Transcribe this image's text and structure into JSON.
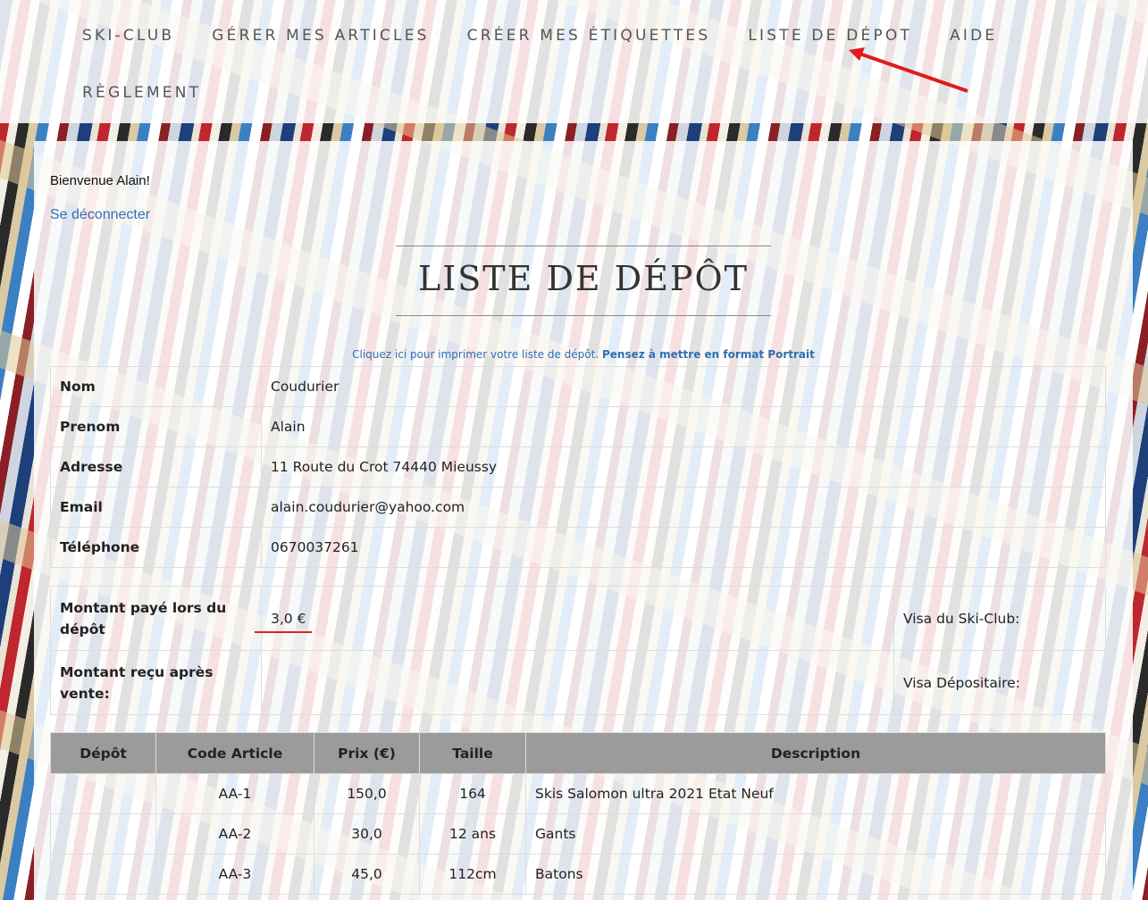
{
  "nav": {
    "items": [
      "SKI-CLUB",
      "GÉRER MES ARTICLES",
      "CRÉER MES ÉTIQUETTES",
      "LISTE DE DÉPOT",
      "AIDE"
    ],
    "row2": [
      "RÈGLEMENT"
    ]
  },
  "welcome": "Bienvenue Alain!",
  "logout": "Se déconnecter",
  "title": "LISTE DE DÉPÔT",
  "print": {
    "text": "Cliquez ici pour imprimer votre liste de dépôt.",
    "bold": "Pensez à mettre en format Portrait"
  },
  "info": [
    {
      "label": "Nom",
      "value": "Coudurier"
    },
    {
      "label": "Prenom",
      "value": "Alain"
    },
    {
      "label": "Adresse",
      "value": "11 Route du Crot 74440 Mieussy"
    },
    {
      "label": "Email",
      "value": "alain.coudurier@yahoo.com"
    },
    {
      "label": "Téléphone",
      "value": "0670037261"
    }
  ],
  "amounts": {
    "paid_label": "Montant payé lors du dépôt",
    "paid_value": "3,0 €",
    "visa_club": "Visa du Ski-Club:",
    "received_label": "Montant reçu après vente:",
    "received_value": "",
    "visa_depositaire": "Visa Dépositaire:"
  },
  "items_table": {
    "headers": [
      "Dépôt",
      "Code Article",
      "Prix (€)",
      "Taille",
      "Description"
    ],
    "rows": [
      {
        "depot": "",
        "code": "AA-1",
        "prix": "150,0",
        "taille": "164",
        "description": "Skis Salomon ultra 2021 Etat Neuf"
      },
      {
        "depot": "",
        "code": "AA-2",
        "prix": "30,0",
        "taille": "12 ans",
        "description": "Gants"
      },
      {
        "depot": "",
        "code": "AA-3",
        "prix": "45,0",
        "taille": "112cm",
        "description": "Batons"
      }
    ]
  },
  "colors": {
    "link": "#2f6fb2",
    "annotation_red": "#dd2222",
    "table_header_bg": "#9b9b9b"
  }
}
